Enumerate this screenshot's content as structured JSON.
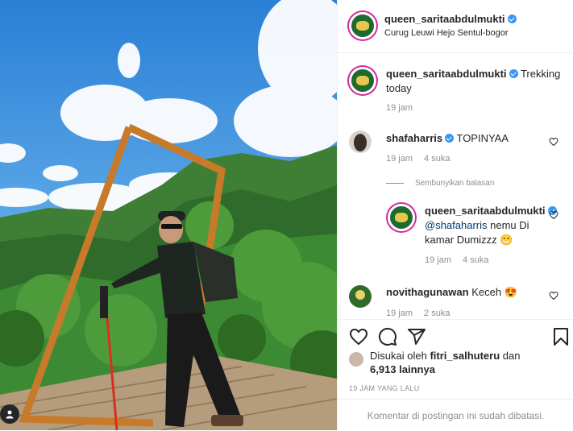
{
  "post": {
    "username": "queen_saritaabdulmukti",
    "location": "Curug Leuwi Hejo Sentul-bogor"
  },
  "caption": {
    "username": "queen_saritaabdulmukti",
    "text": "Trekking",
    "text2": "today",
    "time": "19 jam"
  },
  "comments": [
    {
      "username": "shafaharris",
      "text": "TOPINYAA",
      "time": "19 jam",
      "likes": "4 suka"
    },
    {
      "username": "queen_saritaabdulmukti",
      "mention": "@shafaharris",
      "text": " nemu Di",
      "text2": "kamar Dumizzz 😁",
      "time": "19 jam",
      "likes": "4 suka"
    },
    {
      "username": "novithagunawan",
      "text": "Keceh 😍",
      "time": "19 jam",
      "likes": "2 suka"
    }
  ],
  "hide_replies": "Sembunyikan balasan",
  "likes": {
    "prefix": "Disukai oleh",
    "user": "fitri_salhuteru",
    "mid": "dan",
    "count": "6,913 lainnya"
  },
  "timestamp": "19 JAM YANG LALU",
  "comments_closed": "Komentar di postingan ini sudah dibatasi.",
  "colors": {
    "verified": "#3897f0",
    "story_ring": "#d6249f",
    "muted": "#8e8e8e"
  }
}
